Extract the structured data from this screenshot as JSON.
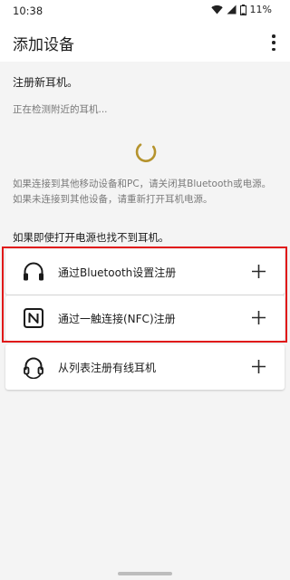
{
  "status_bar": {
    "time": "10:38",
    "battery": "11%",
    "icons": [
      "wifi-icon",
      "signal-icon",
      "battery-icon"
    ]
  },
  "app_bar": {
    "title": "添加设备",
    "menu_icon": "more-vert-icon"
  },
  "content": {
    "section_title": "注册新耳机。",
    "detecting_text": "正在检测附近的耳机...",
    "info_text": "如果连接到其他移动设备和PC，请关闭其Bluetooth或电源。如果未连接到其他设备，请重新打开耳机电源。",
    "not_found_text": "如果即使打开电源也找不到耳机。"
  },
  "options": [
    {
      "label": "通过Bluetooth设置注册",
      "icon": "headphones-icon"
    },
    {
      "label": "通过一触连接(NFC)注册",
      "icon": "nfc-icon"
    },
    {
      "label": "从列表注册有线耳机",
      "icon": "wired-headphones-icon"
    }
  ],
  "colors": {
    "accent": "#b5932d",
    "highlight": "#e01919",
    "background": "#f4f4f4"
  }
}
